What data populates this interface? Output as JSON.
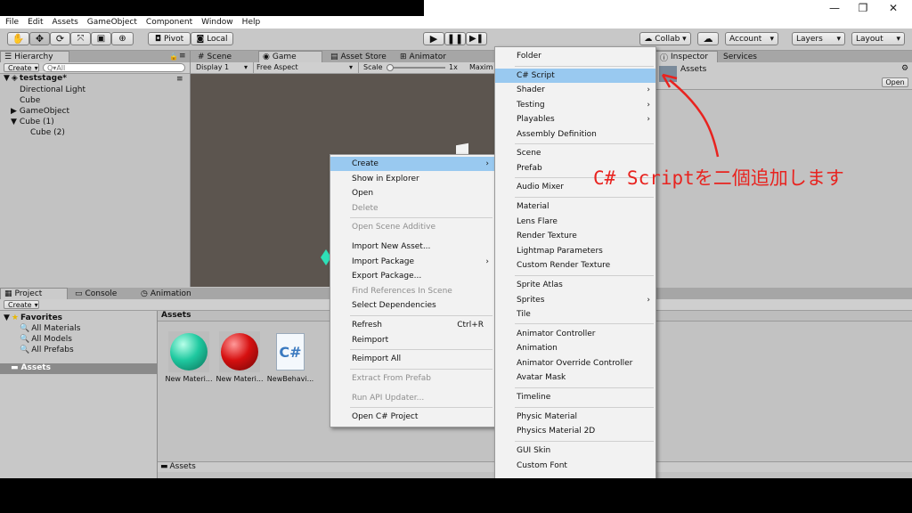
{
  "window": {
    "minimize": "—",
    "restore": "❐",
    "close": "✕"
  },
  "menubar": [
    "File",
    "Edit",
    "Assets",
    "GameObject",
    "Component",
    "Window",
    "Help"
  ],
  "toolbar": {
    "pivot": "Pivot",
    "local": "Local",
    "collab": "Collab ▾",
    "account": "Account",
    "layers": "Layers",
    "layout": "Layout"
  },
  "hierarchy": {
    "tab": "Hierarchy",
    "create": "Create",
    "search_placeholder": "Q▾All",
    "scene": "teststage*",
    "items": [
      "Directional Light",
      "Cube",
      "GameObject",
      "Cube (1)",
      "Cube (2)"
    ]
  },
  "center_tabs": {
    "scene": "Scene",
    "game": "Game",
    "asset_store": "Asset Store",
    "animator": "Animator"
  },
  "game_bar": {
    "display": "Display 1",
    "aspect": "Free Aspect",
    "scale": "Scale",
    "scale_value": "1x",
    "maxim": "Maxim"
  },
  "inspector": {
    "tab": "Inspector",
    "services": "Services",
    "assets": "Assets",
    "open": "Open"
  },
  "bottom_tabs": {
    "project": "Project",
    "console": "Console",
    "animation": "Animation"
  },
  "project": {
    "create": "Create",
    "favorites": "Favorites",
    "fav_items": [
      "All Materials",
      "All Models",
      "All Prefabs"
    ],
    "assets_root": "Assets",
    "assets_header": "Assets",
    "footer": "Assets"
  },
  "asset_files": [
    "New Materi...",
    "New Materi...",
    "NewBehavi..."
  ],
  "context_menu": {
    "items": [
      {
        "label": "Create",
        "arrow": "›"
      },
      {
        "label": "Show in Explorer"
      },
      {
        "label": "Open"
      },
      {
        "label": "Delete"
      },
      {
        "label": "Open Scene Additive"
      },
      {
        "label": "Import New Asset..."
      },
      {
        "label": "Import Package",
        "arrow": "›"
      },
      {
        "label": "Export Package..."
      },
      {
        "label": "Find References In Scene"
      },
      {
        "label": "Select Dependencies"
      },
      {
        "label": "Refresh",
        "shortcut": "Ctrl+R"
      },
      {
        "label": "Reimport"
      },
      {
        "label": "Reimport All"
      },
      {
        "label": "Extract From Prefab"
      },
      {
        "label": "Run API Updater..."
      },
      {
        "label": "Open C# Project"
      }
    ]
  },
  "create_submenu": {
    "items": [
      {
        "label": "Folder"
      },
      {
        "label": "C# Script"
      },
      {
        "label": "Shader",
        "arrow": "›"
      },
      {
        "label": "Testing",
        "arrow": "›"
      },
      {
        "label": "Playables",
        "arrow": "›"
      },
      {
        "label": "Assembly Definition"
      },
      {
        "label": "Scene"
      },
      {
        "label": "Prefab"
      },
      {
        "label": "Audio Mixer"
      },
      {
        "label": "Material"
      },
      {
        "label": "Lens Flare"
      },
      {
        "label": "Render Texture"
      },
      {
        "label": "Lightmap Parameters"
      },
      {
        "label": "Custom Render Texture"
      },
      {
        "label": "Sprite Atlas"
      },
      {
        "label": "Sprites",
        "arrow": "›"
      },
      {
        "label": "Tile"
      },
      {
        "label": "Animator Controller"
      },
      {
        "label": "Animation"
      },
      {
        "label": "Animator Override Controller"
      },
      {
        "label": "Avatar Mask"
      },
      {
        "label": "Timeline"
      },
      {
        "label": "Physic Material"
      },
      {
        "label": "Physics Material 2D"
      },
      {
        "label": "GUI Skin"
      },
      {
        "label": "Custom Font"
      }
    ]
  },
  "annotation": "C# Scriptを二個追加します",
  "colors": {
    "highlight": "#99c9f0",
    "annotation": "#e8231f",
    "material_green": "#1fc9a0",
    "material_red": "#d61010"
  }
}
